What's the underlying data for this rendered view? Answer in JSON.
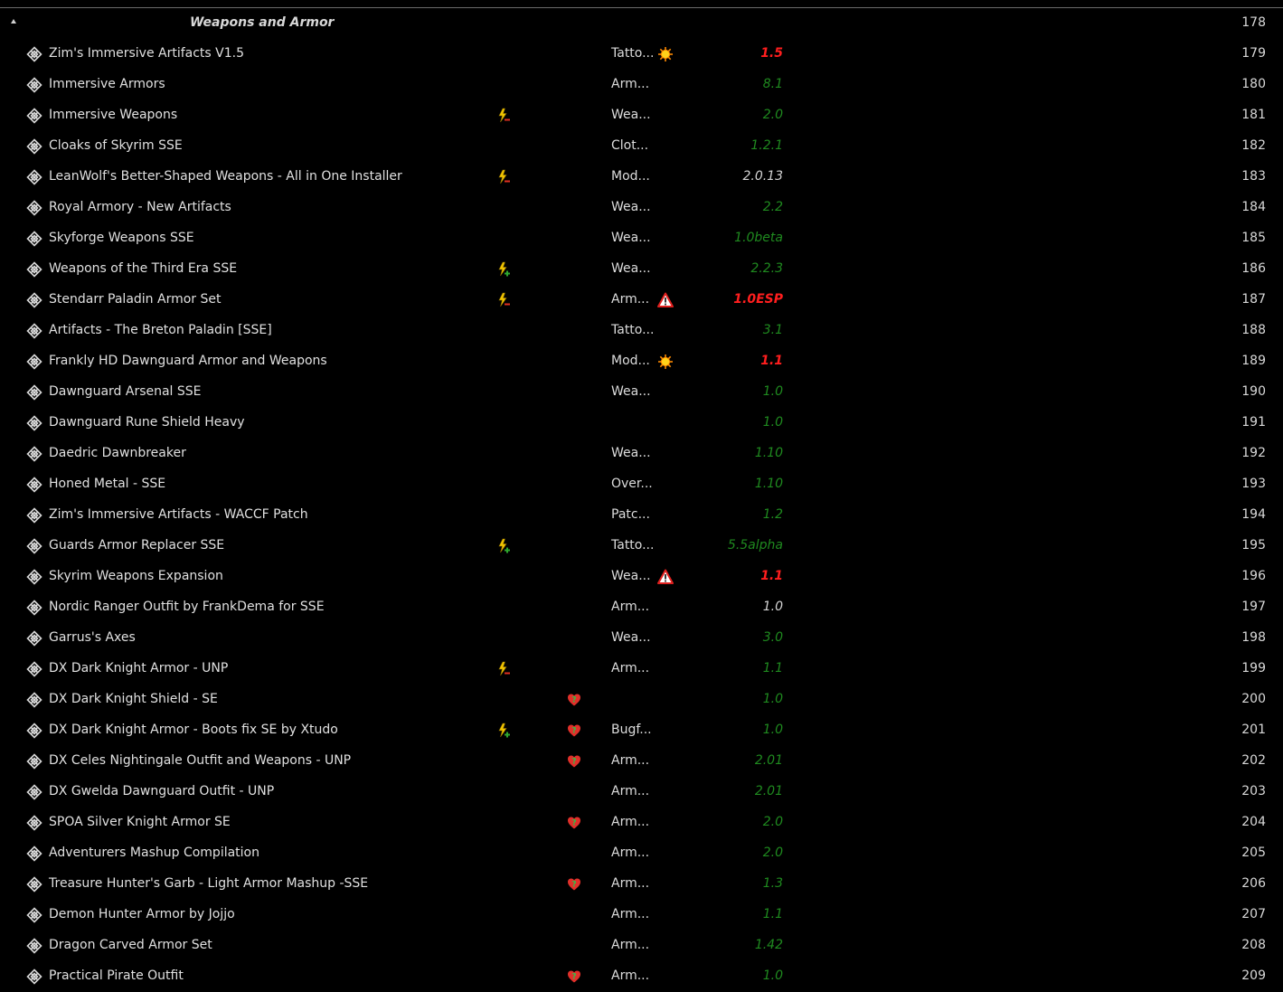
{
  "separator": {
    "title": "Weapons and Armor",
    "priority": "178"
  },
  "rows": [
    {
      "name": "Zim's Immersive Artifacts V1.5",
      "flag1": "",
      "flag2": "",
      "category": "Tatto...",
      "conflict": "sun-warning-icon",
      "version": "1.5",
      "vstyle": "red",
      "priority": "179"
    },
    {
      "name": "Immersive Armors",
      "flag1": "",
      "flag2": "",
      "category": "Arm...",
      "conflict": "",
      "version": "8.1",
      "vstyle": "green",
      "priority": "180"
    },
    {
      "name": "Immersive Weapons",
      "flag1": "lightning-minus-icon",
      "flag2": "",
      "category": "Wea...",
      "conflict": "",
      "version": "2.0",
      "vstyle": "green",
      "priority": "181"
    },
    {
      "name": "Cloaks of Skyrim SSE",
      "flag1": "",
      "flag2": "",
      "category": "Clot...",
      "conflict": "",
      "version": "1.2.1",
      "vstyle": "green",
      "priority": "182"
    },
    {
      "name": "LeanWolf's Better-Shaped Weapons - All in One Installer",
      "flag1": "lightning-minus-icon",
      "flag2": "",
      "category": "Mod...",
      "conflict": "",
      "version": "2.0.13",
      "vstyle": "white",
      "priority": "183"
    },
    {
      "name": "Royal Armory - New Artifacts",
      "flag1": "",
      "flag2": "",
      "category": "Wea...",
      "conflict": "",
      "version": "2.2",
      "vstyle": "green",
      "priority": "184"
    },
    {
      "name": "Skyforge Weapons SSE",
      "flag1": "",
      "flag2": "",
      "category": "Wea...",
      "conflict": "",
      "version": "1.0beta",
      "vstyle": "green",
      "priority": "185"
    },
    {
      "name": "Weapons of the Third Era SSE",
      "flag1": "lightning-plus-icon",
      "flag2": "",
      "category": "Wea...",
      "conflict": "",
      "version": "2.2.3",
      "vstyle": "green",
      "priority": "186"
    },
    {
      "name": "Stendarr Paladin Armor Set",
      "flag1": "lightning-minus-icon",
      "flag2": "",
      "category": "Arm...",
      "conflict": "warning-triangle-icon",
      "version": "1.0ESP",
      "vstyle": "red",
      "priority": "187"
    },
    {
      "name": "Artifacts - The Breton Paladin [SSE]",
      "flag1": "",
      "flag2": "",
      "category": "Tatto...",
      "conflict": "",
      "version": "3.1",
      "vstyle": "green",
      "priority": "188"
    },
    {
      "name": "Frankly HD Dawnguard Armor and Weapons",
      "flag1": "",
      "flag2": "",
      "category": "Mod...",
      "conflict": "sun-warning-icon",
      "version": "1.1",
      "vstyle": "red",
      "priority": "189"
    },
    {
      "name": "Dawnguard Arsenal SSE",
      "flag1": "",
      "flag2": "",
      "category": "Wea...",
      "conflict": "",
      "version": "1.0",
      "vstyle": "green",
      "priority": "190"
    },
    {
      "name": "Dawnguard Rune Shield Heavy",
      "flag1": "",
      "flag2": "",
      "category": "",
      "conflict": "",
      "version": "1.0",
      "vstyle": "green",
      "priority": "191"
    },
    {
      "name": "Daedric Dawnbreaker",
      "flag1": "",
      "flag2": "",
      "category": "Wea...",
      "conflict": "",
      "version": "1.10",
      "vstyle": "green",
      "priority": "192"
    },
    {
      "name": "Honed Metal - SSE",
      "flag1": "",
      "flag2": "",
      "category": "Over...",
      "conflict": "",
      "version": "1.10",
      "vstyle": "green",
      "priority": "193"
    },
    {
      "name": "Zim's Immersive Artifacts - WACCF Patch",
      "flag1": "",
      "flag2": "",
      "category": "Patc...",
      "conflict": "",
      "version": "1.2",
      "vstyle": "green",
      "priority": "194"
    },
    {
      "name": "Guards Armor Replacer SSE",
      "flag1": "lightning-plus-icon",
      "flag2": "",
      "category": "Tatto...",
      "conflict": "",
      "version": "5.5alpha",
      "vstyle": "green",
      "priority": "195"
    },
    {
      "name": "Skyrim Weapons Expansion",
      "flag1": "",
      "flag2": "",
      "category": "Wea...",
      "conflict": "warning-triangle-icon",
      "version": "1.1",
      "vstyle": "red",
      "priority": "196"
    },
    {
      "name": "Nordic Ranger Outfit by FrankDema for SSE",
      "flag1": "",
      "flag2": "",
      "category": "Arm...",
      "conflict": "",
      "version": "1.0",
      "vstyle": "white",
      "priority": "197"
    },
    {
      "name": "Garrus's Axes",
      "flag1": "",
      "flag2": "",
      "category": "Wea...",
      "conflict": "",
      "version": "3.0",
      "vstyle": "green",
      "priority": "198"
    },
    {
      "name": "DX Dark Knight Armor - UNP",
      "flag1": "lightning-minus-icon",
      "flag2": "",
      "category": "Arm...",
      "conflict": "",
      "version": "1.1",
      "vstyle": "green",
      "priority": "199"
    },
    {
      "name": "DX Dark Knight Shield - SE",
      "flag1": "",
      "flag2": "heart-question-icon",
      "category": "",
      "conflict": "",
      "version": "1.0",
      "vstyle": "green",
      "priority": "200"
    },
    {
      "name": "DX Dark Knight Armor - Boots fix SE by Xtudo",
      "flag1": "lightning-plus-icon",
      "flag2": "heart-question-icon",
      "category": "Bugf...",
      "conflict": "",
      "version": "1.0",
      "vstyle": "green",
      "priority": "201"
    },
    {
      "name": "DX Celes Nightingale Outfit and Weapons - UNP",
      "flag1": "",
      "flag2": "heart-question-icon",
      "category": "Arm...",
      "conflict": "",
      "version": "2.01",
      "vstyle": "green",
      "priority": "202"
    },
    {
      "name": "DX Gwelda Dawnguard Outfit - UNP",
      "flag1": "",
      "flag2": "",
      "category": "Arm...",
      "conflict": "",
      "version": "2.01",
      "vstyle": "green",
      "priority": "203"
    },
    {
      "name": "SPOA Silver Knight Armor SE",
      "flag1": "",
      "flag2": "heart-question-icon",
      "category": "Arm...",
      "conflict": "",
      "version": "2.0",
      "vstyle": "green",
      "priority": "204"
    },
    {
      "name": "Adventurers Mashup Compilation",
      "flag1": "",
      "flag2": "",
      "category": "Arm...",
      "conflict": "",
      "version": "2.0",
      "vstyle": "green",
      "priority": "205"
    },
    {
      "name": "Treasure Hunter's Garb - Light Armor Mashup -SSE",
      "flag1": "",
      "flag2": "heart-question-icon",
      "category": "Arm...",
      "conflict": "",
      "version": "1.3",
      "vstyle": "green",
      "priority": "206"
    },
    {
      "name": "Demon Hunter Armor by Jojjo",
      "flag1": "",
      "flag2": "",
      "category": "Arm...",
      "conflict": "",
      "version": "1.1",
      "vstyle": "green",
      "priority": "207"
    },
    {
      "name": "Dragon Carved Armor Set",
      "flag1": "",
      "flag2": "",
      "category": "Arm...",
      "conflict": "",
      "version": "1.42",
      "vstyle": "green",
      "priority": "208"
    },
    {
      "name": "Practical Pirate Outfit",
      "flag1": "",
      "flag2": "heart-question-icon",
      "category": "Arm...",
      "conflict": "",
      "version": "1.0",
      "vstyle": "green",
      "priority": "209"
    }
  ]
}
